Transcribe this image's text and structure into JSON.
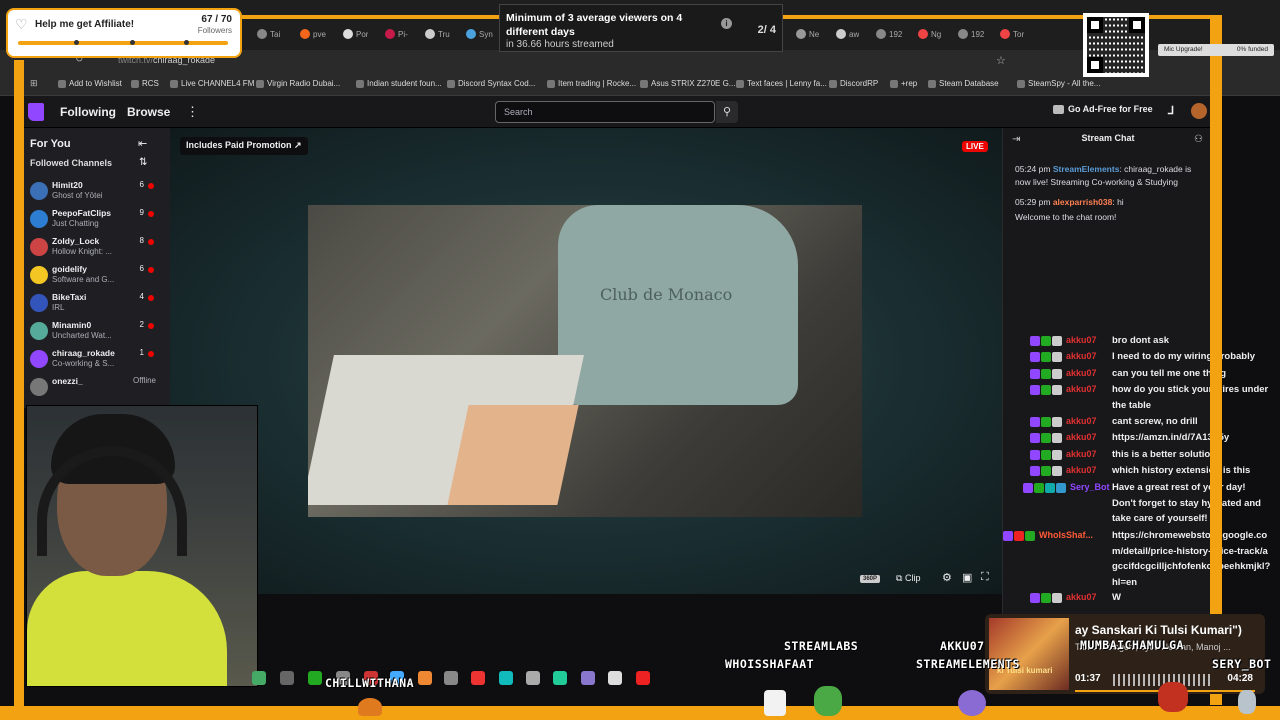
{
  "browser": {
    "tabs": [
      {
        "label": "Tai",
        "color": "#888"
      },
      {
        "label": "pve",
        "color": "#f4661b"
      },
      {
        "label": "Por",
        "color": "#ddd"
      },
      {
        "label": "Pi-",
        "color": "#c51a4a"
      },
      {
        "label": "Tru",
        "color": "#ccc"
      },
      {
        "label": "Syn",
        "color": "#4aa3df"
      },
      {
        "label": "Ne",
        "color": "#999"
      },
      {
        "label": "aw",
        "color": "#ccc"
      },
      {
        "label": "192",
        "color": "#888"
      },
      {
        "label": "Ng",
        "color": "#e44"
      },
      {
        "label": "192",
        "color": "#888"
      },
      {
        "label": "Tor",
        "color": "#e44"
      }
    ],
    "url_host": "twitch.tv/",
    "url_path": "chiraag_rokade",
    "bookmarks": [
      "Add to Wishlist",
      "RCS",
      "Live CHANNEL4 FM",
      "Virgin Radio Dubai...",
      "Indian student foun...",
      "Discord Syntax Cod...",
      "Item trading | Rocke...",
      "Asus STRIX Z270E G...",
      "Text faces | Lenny fa...",
      "DiscordRP",
      "+rep",
      "Steam Database",
      "SteamSpy - All the..."
    ]
  },
  "twitch": {
    "nav_following": "Following",
    "nav_browse": "Browse",
    "search_placeholder": "Search",
    "ad_free": "Go Ad-Free for Free"
  },
  "sidebar": {
    "title": "For You",
    "subtitle": "Followed Channels",
    "channels": [
      {
        "name": "Himit20",
        "game": "Ghost of Yōtei",
        "viewers": "6",
        "color": "#3b6fb6"
      },
      {
        "name": "PeepoFatClips",
        "game": "Just Chatting",
        "viewers": "9",
        "color": "#2d7dd2"
      },
      {
        "name": "Zoldy_Lock",
        "game": "Hollow Knight: ...",
        "viewers": "8",
        "color": "#c44"
      },
      {
        "name": "goidelify",
        "game": "Software and G...",
        "viewers": "6",
        "color": "#f3c623"
      },
      {
        "name": "BikeTaxi",
        "game": "IRL",
        "viewers": "4",
        "color": "#35b"
      },
      {
        "name": "Minamin0",
        "game": "Uncharted Wat...",
        "viewers": "2",
        "color": "#5a9"
      },
      {
        "name": "chiraag_rokade",
        "game": "Co-working & S...",
        "viewers": "1",
        "color": "#9147ff"
      },
      {
        "name": "onezzi_",
        "game": "",
        "viewers": "Offline",
        "color": "#777"
      }
    ]
  },
  "player": {
    "promo": "Includes Paid Promotion",
    "live": "LIVE",
    "shirt_text": "Club de Monaco",
    "quality": "360P",
    "clip": "Clip"
  },
  "chat": {
    "title": "Stream Chat",
    "system": [
      {
        "time": "05:24 pm",
        "user": "StreamElements",
        "text": ": chiraag_rokade is now live! Streaming Co-working & Studying",
        "color": "#5b9bd5"
      },
      {
        "time": "05:29 pm",
        "user": "alexparrish038",
        "text": ": hi",
        "color": "#ff7f50"
      }
    ],
    "welcome": "Welcome to the chat room!",
    "messages": [
      {
        "user": "akku07",
        "text": "bro dont ask",
        "color": "#e03030"
      },
      {
        "user": "akku07",
        "text": "I need to do my wiring probably",
        "color": "#e03030"
      },
      {
        "user": "akku07",
        "text": "can you tell me one thing",
        "color": "#e03030"
      },
      {
        "user": "akku07",
        "text": "how do you stick your wires under the table",
        "color": "#e03030"
      },
      {
        "user": "akku07",
        "text": "cant screw, no drill",
        "color": "#e03030"
      },
      {
        "user": "akku07",
        "text": "https://amzn.in/d/7A13L5y",
        "color": "#e03030"
      },
      {
        "user": "akku07",
        "text": "this is a better solution",
        "color": "#e03030"
      },
      {
        "user": "akku07",
        "text": "which history extension is this",
        "color": "#e03030"
      },
      {
        "user": "Sery_Bot",
        "text": "Have a great rest of your day! Don't forget to stay hydrated and take care of yourself!",
        "color": "#9147ff"
      },
      {
        "user": "WhoIsShaf...",
        "text": "https://chromewebstore.google.com/detail/price-history-price-track/agccifdcgcilljchfofenkoboeehkmjkl?hl=en",
        "color": "#ff5a36"
      },
      {
        "user": "akku07",
        "text": "W",
        "color": "#e03030"
      }
    ]
  },
  "overlay": {
    "affiliate_label": "Help me get Affiliate!",
    "affiliate_count": "67 / 70",
    "affiliate_progress": 0.957,
    "followers_label": "Followers",
    "goal_text": "Minimum of 3 average viewers on 4 different days",
    "goal_sub": "in 36.66 hours streamed",
    "goal_step": "2/ 4",
    "mic_upgrade": "Mic Upgrade!",
    "mic_funded": "0% funded",
    "names": [
      "STREAMLABS",
      "AKKU07",
      "WHOISSHAFAAT",
      "STREAMELEMENTS",
      "SERY_BOT",
      "CHILLWITHANA",
      "MUMBAICHAMULGA"
    ],
    "song_title": "ay Sanskari Ki Tulsi Kumari\")",
    "song_artist": "Tanishk Bagchi, Jyoti Nooran, Manoj ...",
    "time_elapsed": "01:37",
    "time_total": "04:28",
    "album_text": "ki Tulsi kumari"
  },
  "colors": {
    "accent": "#9147ff",
    "frame": "#f3a312",
    "live": "#eb0400"
  }
}
